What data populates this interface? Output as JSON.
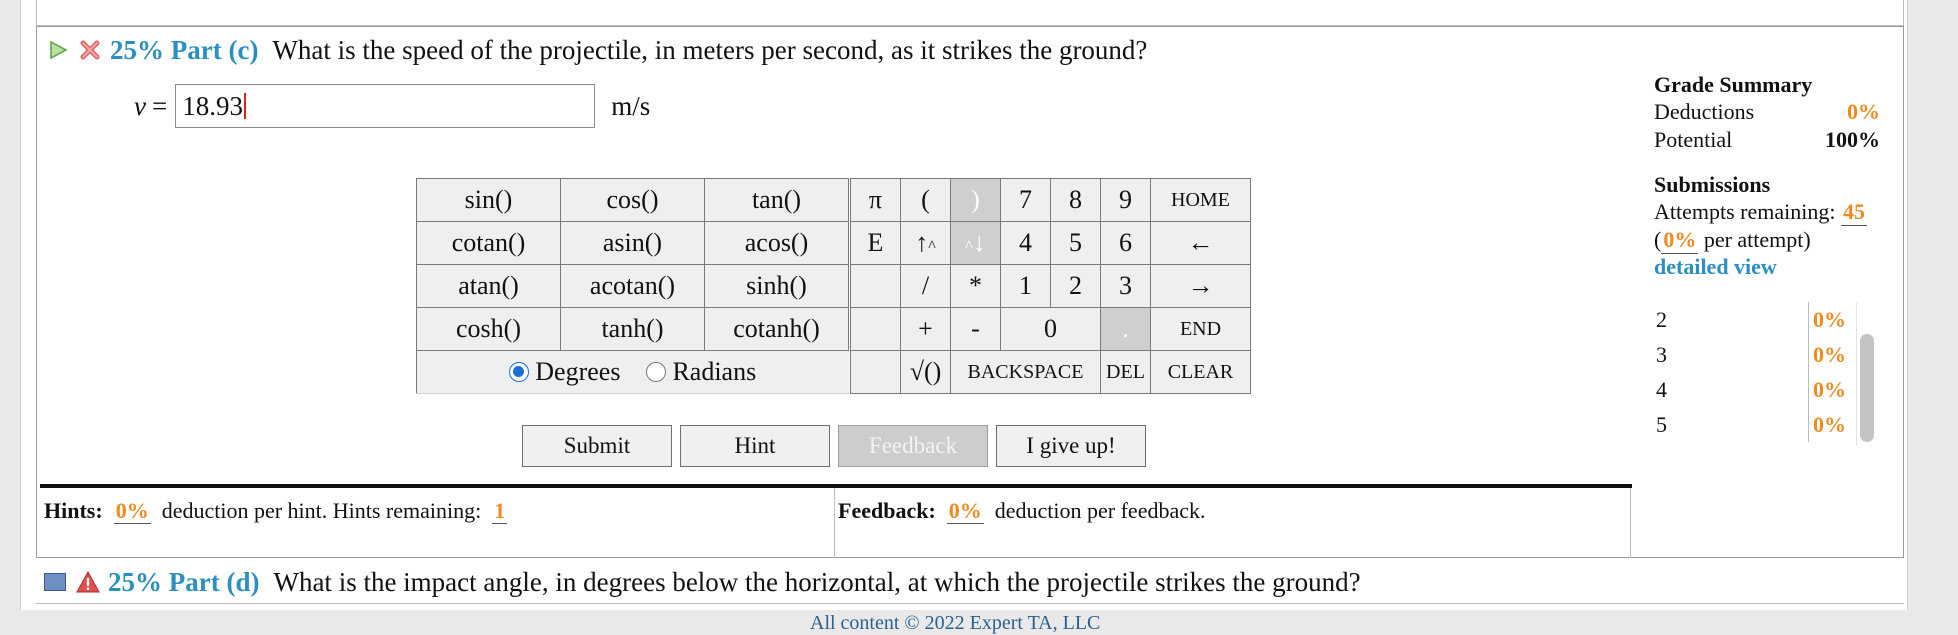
{
  "part_c": {
    "percent": "25%",
    "label": "Part (c)",
    "question": "What is the speed of the projectile, in meters per second, as it strikes the ground?",
    "variable": "v",
    "equals": "=",
    "answer_value": "18.93",
    "unit": "m/s"
  },
  "functions": [
    [
      "sin()",
      "cos()",
      "tan()"
    ],
    [
      "cotan()",
      "asin()",
      "acos()"
    ],
    [
      "atan()",
      "acotan()",
      "sinh()"
    ],
    [
      "cosh()",
      "tanh()",
      "cotanh()"
    ]
  ],
  "angle_mode": {
    "degrees": "Degrees",
    "radians": "Radians",
    "selected": "Degrees"
  },
  "keypad": {
    "pi": "π",
    "open_paren": "(",
    "close_paren": ")",
    "e": "E",
    "up_arrow": "↑",
    "caret_up": "^",
    "down_arrow": "↓",
    "divide": "/",
    "multiply": "*",
    "plus": "+",
    "minus": "-",
    "dot": ".",
    "sqrt": "√()",
    "digits": [
      "7",
      "8",
      "9",
      "4",
      "5",
      "6",
      "1",
      "2",
      "3",
      "0"
    ],
    "home": "HOME",
    "left": "←",
    "right": "→",
    "end": "END",
    "backspace": "BACKSPACE",
    "del": "DEL",
    "clear": "CLEAR"
  },
  "buttons": {
    "submit": "Submit",
    "hint": "Hint",
    "feedback": "Feedback",
    "give_up": "I give up!"
  },
  "grade_summary": {
    "title": "Grade Summary",
    "deductions_label": "Deductions",
    "deductions_value": "0%",
    "potential_label": "Potential",
    "potential_value": "100%"
  },
  "submissions": {
    "title": "Submissions",
    "attempts_label": "Attempts remaining:",
    "attempts_value": "45",
    "per_attempt_open": "(",
    "per_attempt_value": "0%",
    "per_attempt_text": "per attempt)",
    "detailed_view": "detailed view",
    "rows": [
      {
        "n": "2",
        "v": "0%"
      },
      {
        "n": "3",
        "v": "0%"
      },
      {
        "n": "4",
        "v": "0%"
      },
      {
        "n": "5",
        "v": "0%"
      }
    ]
  },
  "hints": {
    "label": "Hints:",
    "pct": "0%",
    "text": "deduction per hint. Hints remaining:",
    "remaining": "1"
  },
  "feedback": {
    "label": "Feedback:",
    "pct": "0%",
    "text": "deduction per feedback."
  },
  "part_d": {
    "percent": "25%",
    "label": "Part (d)",
    "question": "What is the impact angle, in degrees below the horizontal, at which the projectile strikes the ground?"
  },
  "footer": "All content © 2022 Expert TA, LLC",
  "colors": {
    "accent": "#2b8fbf",
    "orange": "#f08a1c",
    "error": "#d9534f"
  }
}
